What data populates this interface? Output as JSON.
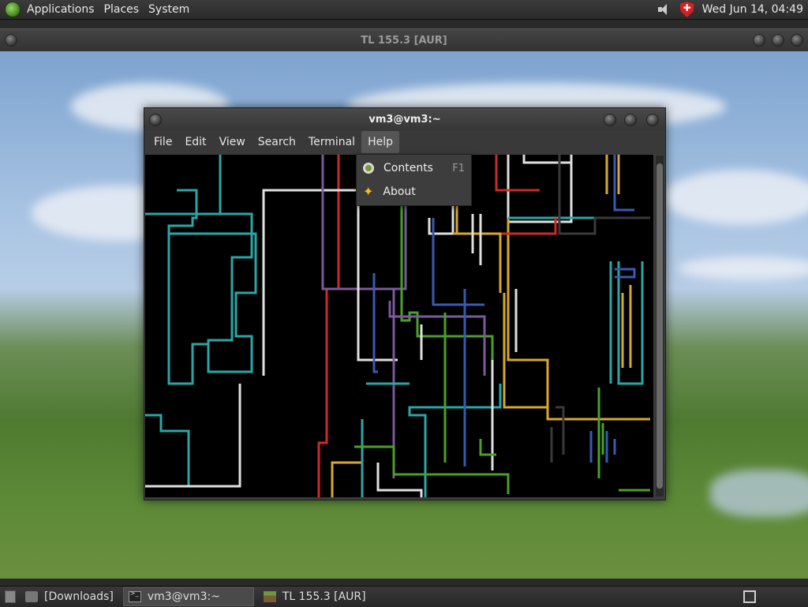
{
  "top_panel": {
    "menus": [
      "Applications",
      "Places",
      "System"
    ],
    "clock": "Wed Jun 14, 04:49"
  },
  "outer_window": {
    "title": "TL 155.3 [AUR]"
  },
  "terminal": {
    "title": "vm3@vm3:~",
    "menu": [
      "File",
      "Edit",
      "View",
      "Search",
      "Terminal",
      "Help"
    ],
    "active_menu": "Help"
  },
  "help_menu": {
    "items": [
      {
        "label": "Contents",
        "accel": "F1",
        "icon": "help-contents-icon"
      },
      {
        "label": "About",
        "accel": "",
        "icon": "about-star-icon"
      }
    ]
  },
  "taskbar": {
    "tasks": [
      {
        "label": "[Downloads]",
        "icon": "folder-icon"
      },
      {
        "label": "vm3@vm3:~",
        "icon": "terminal-icon",
        "active": true
      },
      {
        "label": "TL 155.3 [AUR]",
        "icon": "minecraft-icon"
      }
    ]
  },
  "pipes": {
    "colors": [
      "#2aa6a6",
      "#e0e0e0",
      "#cc2a2a",
      "#7a5a9a",
      "#d8a830",
      "#4aa02a",
      "#3a5ab0",
      "#3a3a3a"
    ]
  }
}
